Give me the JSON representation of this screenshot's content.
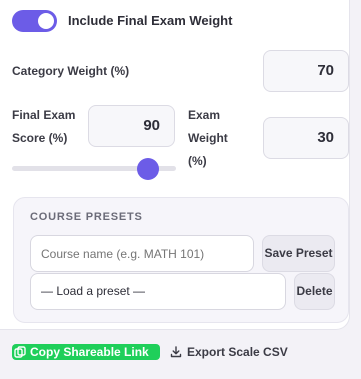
{
  "toggle": {
    "label": "Include Final Exam Weight",
    "on": true
  },
  "category_weight": {
    "label": "Category Weight (%)",
    "value": "70"
  },
  "final_exam_score": {
    "label_line1": "Final Exam",
    "label_line2": "Score (%)",
    "value": "90",
    "slider_value": 90,
    "slider_min": 0,
    "slider_max": 100
  },
  "exam_weight": {
    "label_line1": "Exam",
    "label_line2": "Weight",
    "label_line3": "(%)",
    "value": "30"
  },
  "presets": {
    "title": "COURSE PRESETS",
    "name_placeholder": "Course name (e.g. MATH 101)",
    "save_label": "Save Preset",
    "select_value": "— Load a preset —",
    "delete_label": "Delete"
  },
  "actions": {
    "copy_label": "Copy Shareable Link",
    "copy_icon": "copy-icon",
    "copy_color": "#1fcf5a",
    "export_label": "Export Scale CSV",
    "export_icon": "download-icon"
  },
  "colors": {
    "accent": "#6c5ce7"
  }
}
